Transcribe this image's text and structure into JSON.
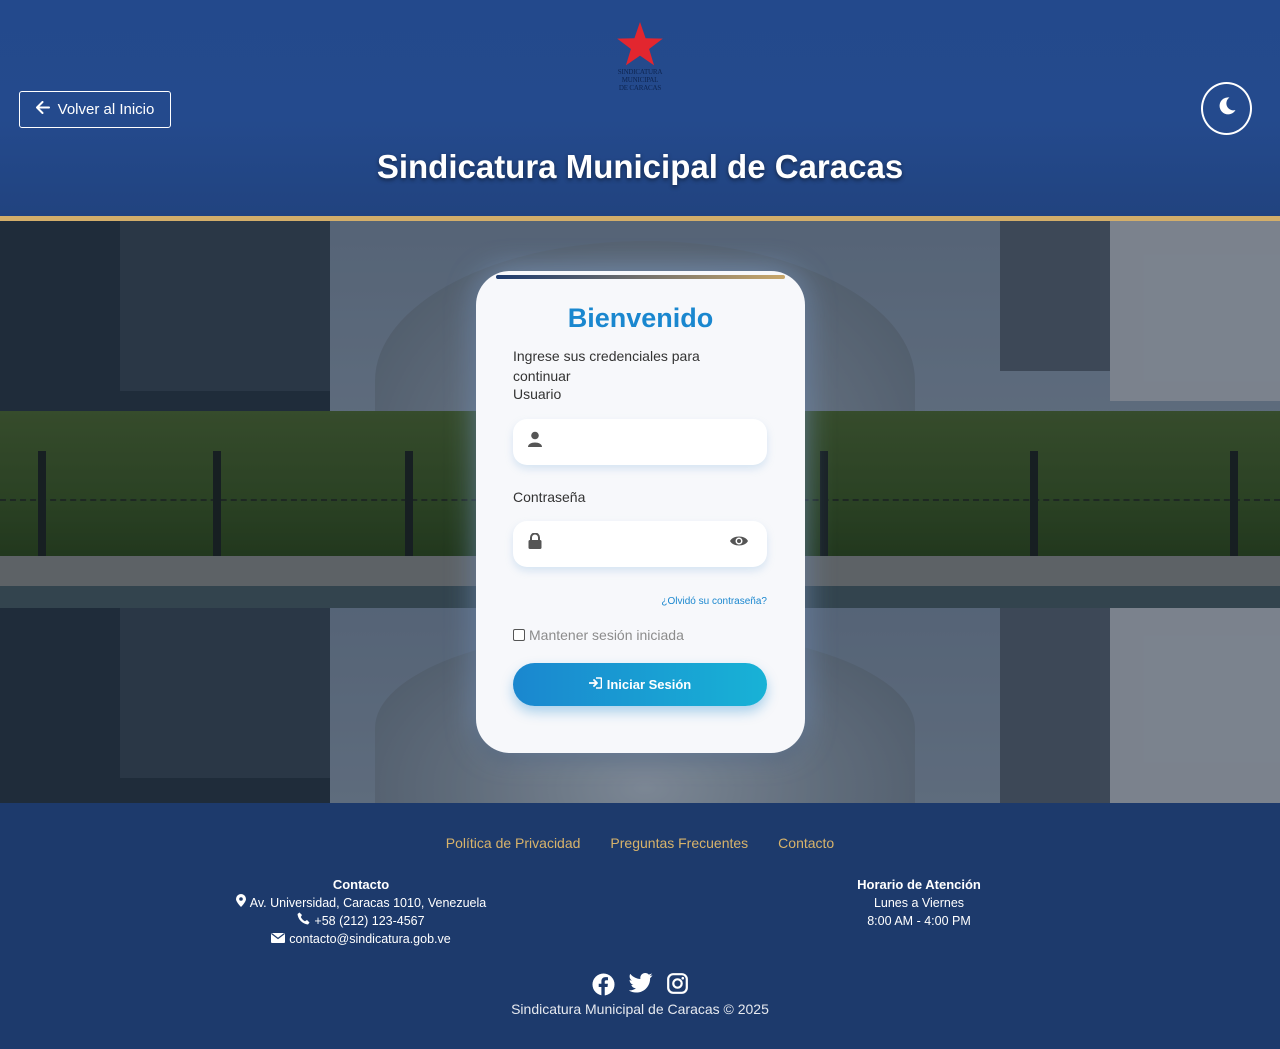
{
  "header": {
    "logo_text": [
      "SINDICATURA",
      "MUNICIPAL",
      "DE CARACAS"
    ],
    "back_label": "Volver al Inicio",
    "title": "Sindicatura Municipal de Caracas",
    "theme_icon": "moon-icon"
  },
  "login": {
    "welcome": "Bienvenido",
    "subtitle": "Ingrese sus credenciales para continuar",
    "user_label": "Usuario",
    "user_value": "",
    "user_icon": "user-icon",
    "password_label": "Contraseña",
    "password_value": "",
    "password_icon": "lock-icon",
    "show_password_icon": "eye-icon",
    "forgot_label": "¿Olvidó su contraseña?",
    "remember_label": "Mantener sesión iniciada",
    "remember_checked": false,
    "submit_label": "Iniciar Sesión",
    "submit_icon": "sign-in-icon"
  },
  "footer": {
    "links": [
      "Política de Privacidad",
      "Preguntas Frecuentes",
      "Contacto"
    ],
    "contact": {
      "heading": "Contacto",
      "address": "Av. Universidad, Caracas 1010, Venezuela",
      "phone": "+58 (212) 123-4567",
      "email": "contacto@sindicatura.gob.ve"
    },
    "hours": {
      "heading": "Horario de Atención",
      "days": "Lunes a Viernes",
      "time": "8:00 AM - 4:00 PM"
    },
    "social": [
      "facebook-icon",
      "twitter-icon",
      "instagram-icon"
    ],
    "copyright": "Sindicatura Municipal de Caracas © 2025"
  },
  "colors": {
    "header_bg": "#244a8d",
    "accent_gold": "#d3ae6a",
    "primary_blue": "#1a87cf",
    "footer_bg": "#1d3a6c"
  }
}
